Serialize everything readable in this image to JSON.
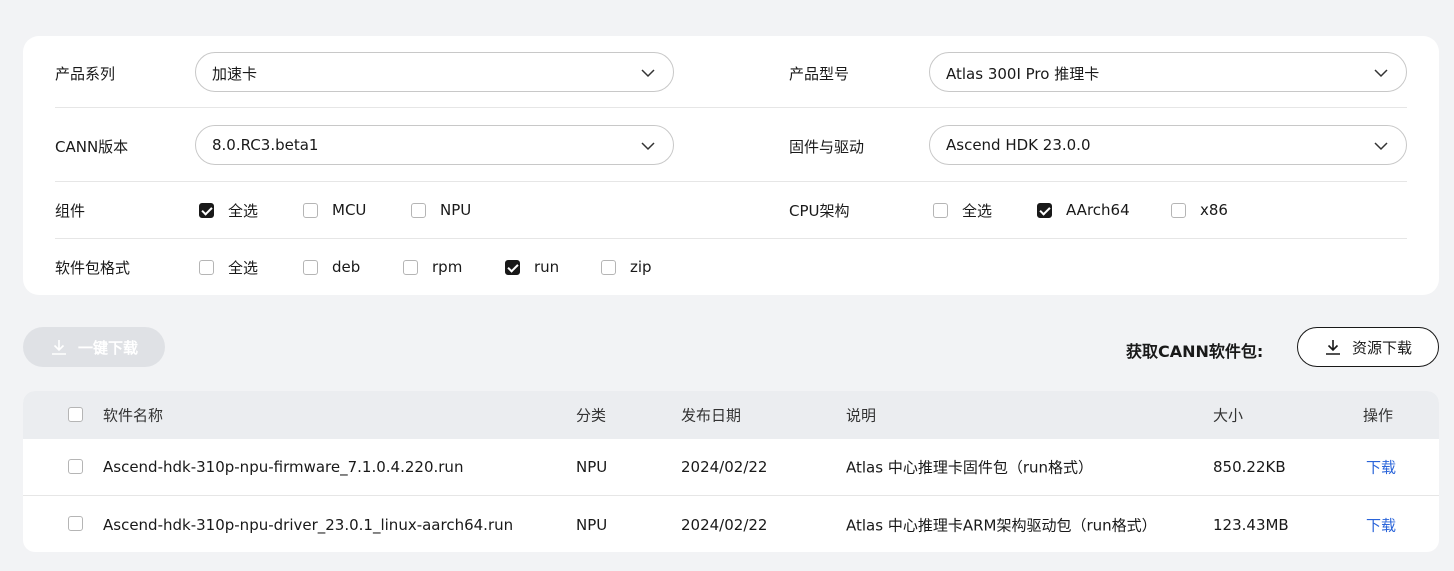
{
  "filters": {
    "product_series": {
      "label": "产品系列",
      "value": "加速卡"
    },
    "product_model": {
      "label": "产品型号",
      "value": "Atlas 300I Pro 推理卡"
    },
    "cann_version": {
      "label": "CANN版本",
      "value": "8.0.RC3.beta1"
    },
    "firmware_driver": {
      "label": "固件与驱动",
      "value": "Ascend HDK 23.0.0"
    },
    "component": {
      "label": "组件",
      "options": [
        {
          "label": "全选",
          "checked": true
        },
        {
          "label": "MCU",
          "checked": false
        },
        {
          "label": "NPU",
          "checked": false
        }
      ]
    },
    "cpu_arch": {
      "label": "CPU架构",
      "options": [
        {
          "label": "全选",
          "checked": false
        },
        {
          "label": "AArch64",
          "checked": true
        },
        {
          "label": "x86",
          "checked": false
        }
      ]
    },
    "package_format": {
      "label": "软件包格式",
      "options": [
        {
          "label": "全选",
          "checked": false
        },
        {
          "label": "deb",
          "checked": false
        },
        {
          "label": "rpm",
          "checked": false
        },
        {
          "label": "run",
          "checked": true
        },
        {
          "label": "zip",
          "checked": false
        }
      ]
    }
  },
  "actions": {
    "download_all_label": "一键下载",
    "get_cann_label": "获取CANN软件包:",
    "resource_download_label": "资源下载"
  },
  "table": {
    "columns": [
      "软件名称",
      "分类",
      "发布日期",
      "说明",
      "大小",
      "操作"
    ],
    "rows": [
      {
        "name": "Ascend-hdk-310p-npu-firmware_7.1.0.4.220.run",
        "category": "NPU",
        "date": "2024/02/22",
        "description": "Atlas 中心推理卡固件包（run格式）",
        "size": "850.22KB",
        "action": "下载"
      },
      {
        "name": "Ascend-hdk-310p-npu-driver_23.0.1_linux-aarch64.run",
        "category": "NPU",
        "date": "2024/02/22",
        "description": "Atlas 中心推理卡ARM架构驱动包（run格式）",
        "size": "123.43MB",
        "action": "下载"
      }
    ]
  },
  "colors": {
    "link": "#2a64d9",
    "checked": "#191919",
    "page_bg": "#f2f3f5"
  }
}
